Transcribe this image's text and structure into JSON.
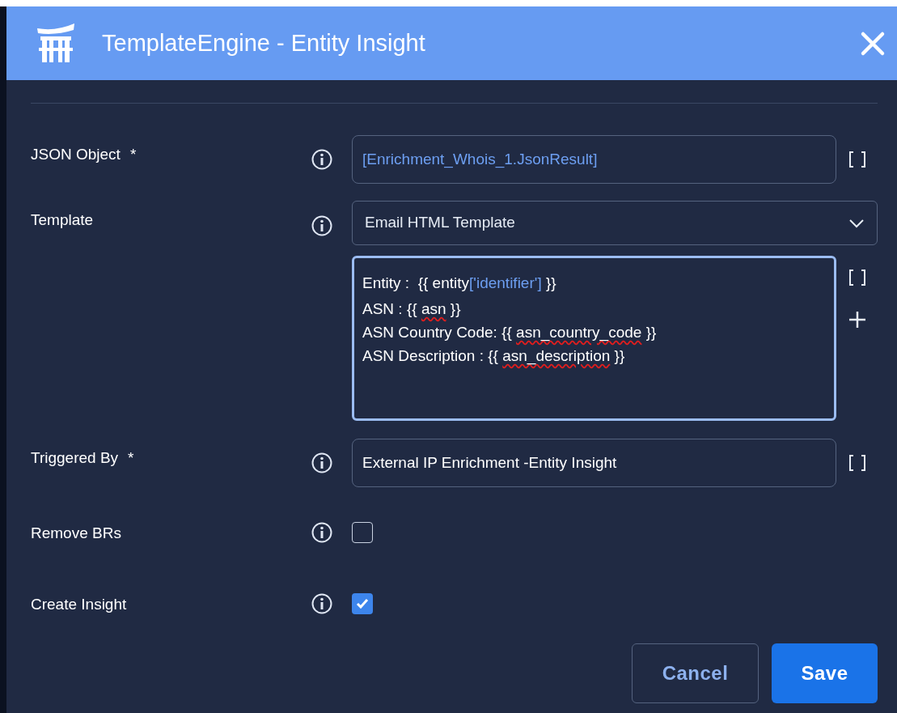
{
  "dialog": {
    "title": "TemplateEngine - Entity Insight"
  },
  "rows": [
    {
      "kind": "input",
      "label": "JSON Object",
      "required_mark": "*",
      "value": "[Enrichment_Whois_1.JsonResult]",
      "variable": true
    },
    {
      "kind": "template",
      "label": "Template",
      "select": {
        "value": "Email HTML Template"
      },
      "editor": {
        "lines": [
          [
            {
              "text": "Entity :  {{ entity",
              "kind": "plain"
            },
            {
              "text": "['identifier']",
              "kind": "string"
            },
            {
              "text": " }}",
              "kind": "plain"
            }
          ],
          [
            {
              "text": "ASN : {{ ",
              "kind": "plain"
            },
            {
              "text": "asn",
              "kind": "misspelled"
            },
            {
              "text": " }}",
              "kind": "plain"
            }
          ],
          [
            {
              "text": "ASN Country Code: {{ ",
              "kind": "plain"
            },
            {
              "text": "asn_country_code",
              "kind": "misspelled"
            },
            {
              "text": " }}",
              "kind": "plain"
            }
          ],
          [
            {
              "text": "ASN Description : {{ ",
              "kind": "plain"
            },
            {
              "text": "asn_description",
              "kind": "misspelled"
            },
            {
              "text": " }}",
              "kind": "plain"
            }
          ]
        ]
      }
    },
    {
      "kind": "input",
      "label": "Triggered By",
      "required_mark": "*",
      "value": "External IP Enrichment -Entity Insight",
      "variable": false
    },
    {
      "kind": "checkbox",
      "label": "Remove BRs",
      "checked": false
    },
    {
      "kind": "checkbox",
      "label": "Create Insight",
      "checked": true
    }
  ],
  "buttons": [
    {
      "kind": "secondary",
      "label": "Cancel"
    },
    {
      "kind": "primary",
      "label": "Save"
    }
  ]
}
